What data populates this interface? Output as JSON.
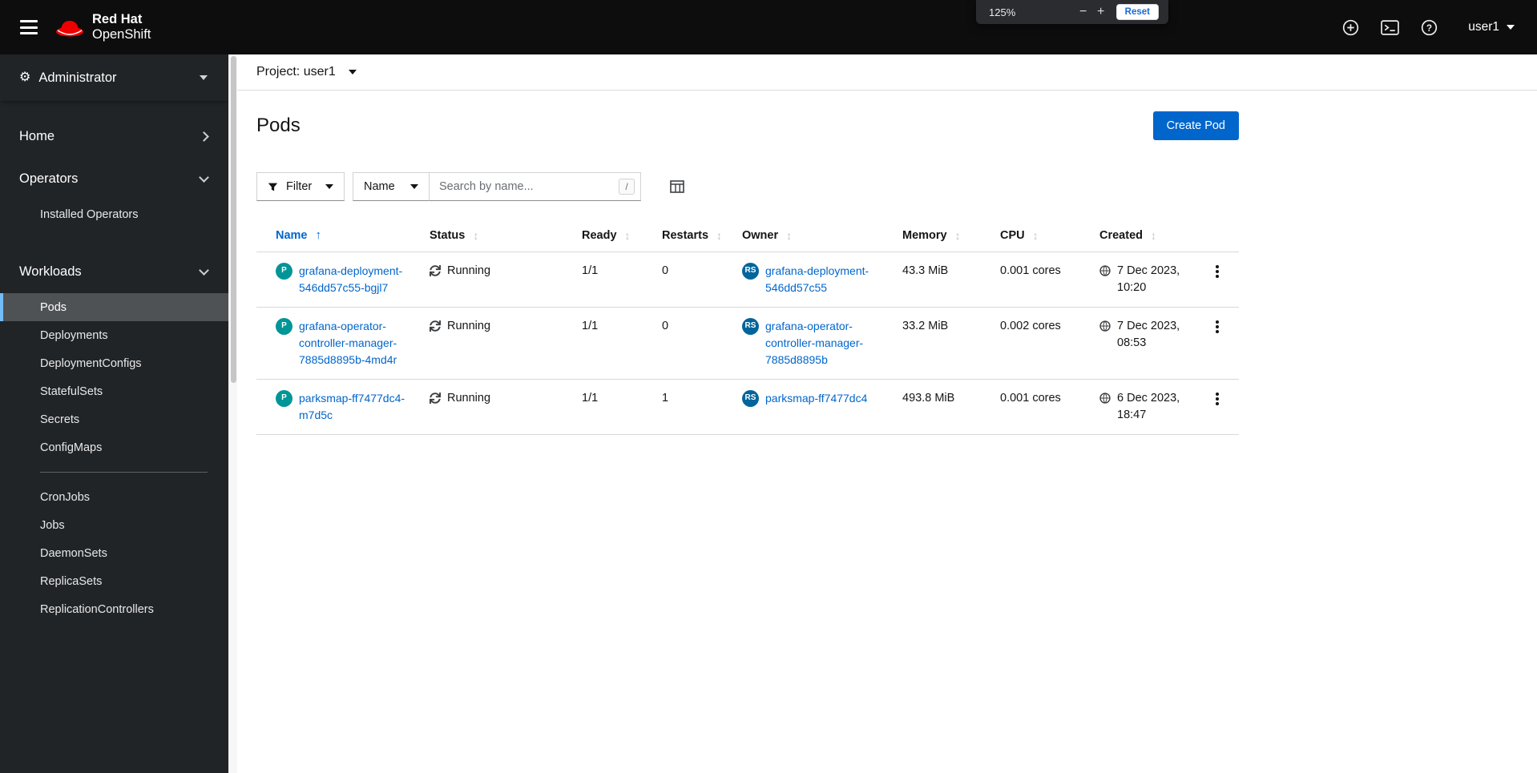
{
  "masthead": {
    "brand_line1": "Red Hat",
    "brand_line2": "OpenShift",
    "user_label": "user1"
  },
  "zoom_popup": {
    "level": "125%",
    "minus_label": "−",
    "plus_label": "+",
    "reset_label": "Reset"
  },
  "sidebar": {
    "perspective_label": "Administrator",
    "gear_glyph": "⚙",
    "section_home": "Home",
    "section_operators": "Operators",
    "section_workloads": "Workloads",
    "operators_items": [
      {
        "label": "Installed Operators"
      }
    ],
    "workloads_items_group1": [
      {
        "label": "Pods",
        "modifier": "selected"
      },
      {
        "label": "Deployments"
      },
      {
        "label": "DeploymentConfigs"
      },
      {
        "label": "StatefulSets"
      },
      {
        "label": "Secrets"
      },
      {
        "label": "ConfigMaps"
      }
    ],
    "workloads_items_group2": [
      {
        "label": "CronJobs"
      },
      {
        "label": "Jobs"
      },
      {
        "label": "DaemonSets"
      },
      {
        "label": "ReplicaSets"
      },
      {
        "label": "ReplicationControllers"
      }
    ]
  },
  "project_bar": {
    "label": "Project: user1"
  },
  "page": {
    "title": "Pods",
    "create_button_label": "Create Pod"
  },
  "toolbar": {
    "filter_label": "Filter",
    "attribute_label": "Name",
    "search_placeholder": "Search by name...",
    "shortcut_hint": "/"
  },
  "table": {
    "headers": {
      "name": "Name",
      "status": "Status",
      "ready": "Ready",
      "restarts": "Restarts",
      "owner": "Owner",
      "memory": "Memory",
      "cpu": "CPU",
      "created": "Created"
    },
    "sort_asc_glyph": "↑",
    "sort_idle_glyph": "↕",
    "rows": [
      {
        "badge": "P",
        "name": "grafana-deployment-546dd57c55-bgjl7",
        "status": "Running",
        "ready": "1/1",
        "restarts": "0",
        "owner_badge": "RS",
        "owner": "grafana-deployment-546dd57c55",
        "memory": "43.3 MiB",
        "cpu": "0.001 cores",
        "created": "7 Dec 2023, 10:20"
      },
      {
        "badge": "P",
        "name": "grafana-operator-controller-manager-7885d8895b-4md4r",
        "status": "Running",
        "ready": "1/1",
        "restarts": "0",
        "owner_badge": "RS",
        "owner": "grafana-operator-controller-manager-7885d8895b",
        "memory": "33.2 MiB",
        "cpu": "0.002 cores",
        "created": "7 Dec 2023, 08:53"
      },
      {
        "badge": "P",
        "name": "parksmap-ff7477dc4-m7d5c",
        "status": "Running",
        "ready": "1/1",
        "restarts": "1",
        "owner_badge": "RS",
        "owner": "parksmap-ff7477dc4",
        "memory": "493.8 MiB",
        "cpu": "0.001 cores",
        "created": "6 Dec 2023, 18:47"
      }
    ]
  },
  "colors": {
    "accent_blue": "#0066cc",
    "pod_badge": "#009596",
    "replicaset_badge": "#00659c",
    "selected_nav_border": "#73bcf7",
    "masthead_bg": "#0d0d0d",
    "sidebar_bg": "#212427"
  }
}
